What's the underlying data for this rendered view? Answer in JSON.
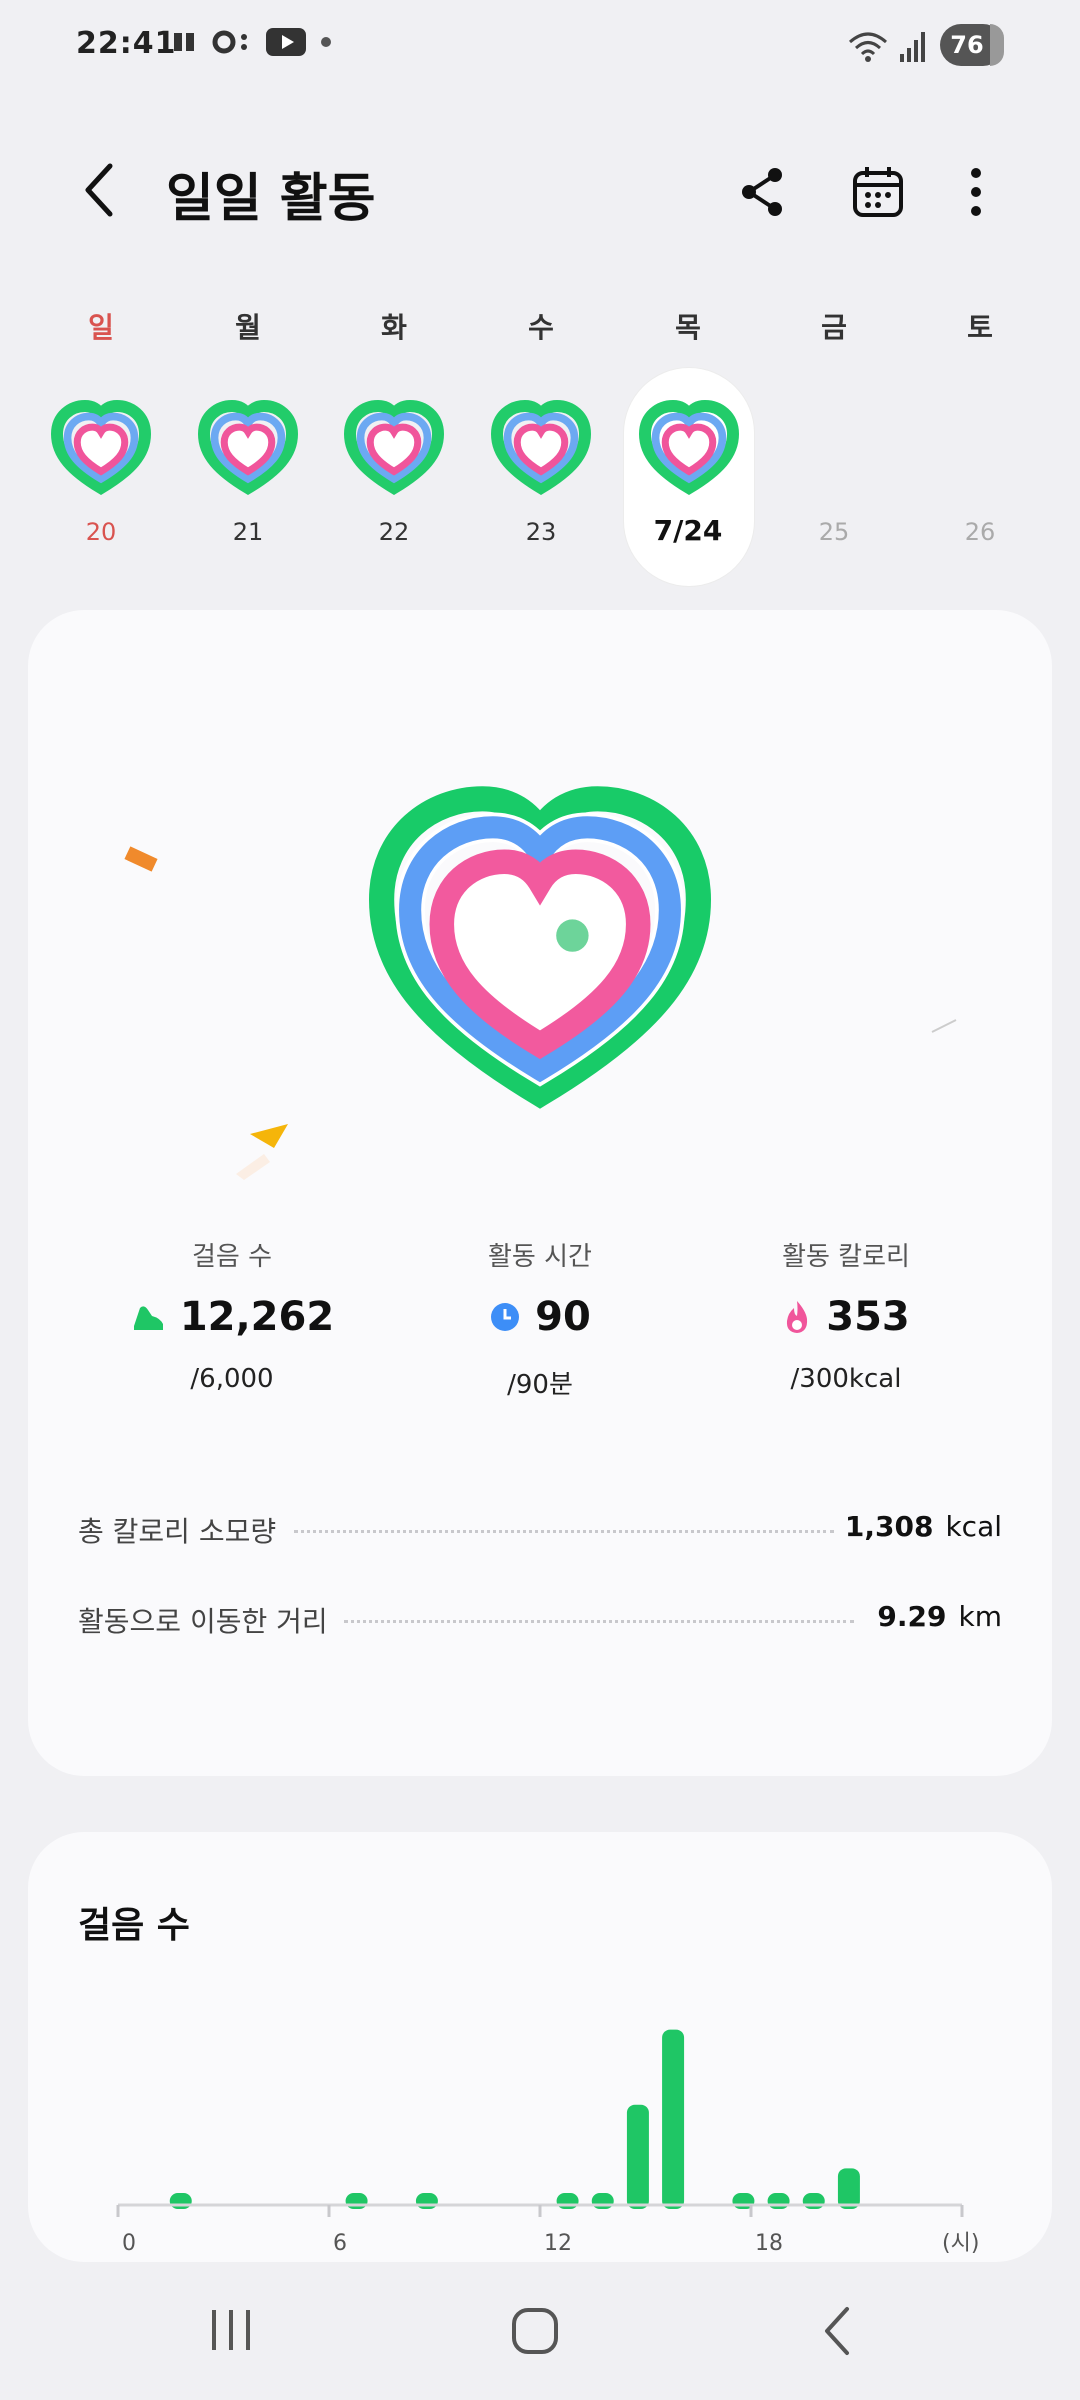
{
  "status": {
    "time": "22:41",
    "battery": "76"
  },
  "header": {
    "title": "일일 활동"
  },
  "week": {
    "day_labels": [
      "일",
      "월",
      "화",
      "수",
      "목",
      "금",
      "토"
    ],
    "dates": [
      "20",
      "21",
      "22",
      "23",
      "7/24",
      "25",
      "26"
    ]
  },
  "metrics": [
    {
      "label": "걸음 수",
      "value": "12,262",
      "goal": "/6,000",
      "icon": "shoe-icon",
      "color": "#1fc665"
    },
    {
      "label": "활동 시간",
      "value": "90",
      "goal": "/90분",
      "icon": "clock-icon",
      "color": "#3d8ef7"
    },
    {
      "label": "활동 칼로리",
      "value": "353",
      "goal": "/300kcal",
      "icon": "flame-icon",
      "color": "#f0559b"
    }
  ],
  "summary": {
    "total_calories_label": "총 칼로리 소모량",
    "total_calories_value": "1,308",
    "total_calories_unit": "kcal",
    "distance_label": "활동으로 이동한 거리",
    "distance_value": "9.29",
    "distance_unit": "km"
  },
  "steps_card": {
    "title": "걸음 수"
  },
  "chart_data": {
    "type": "bar",
    "xlabel": "(시)",
    "x_ticks": [
      "0",
      "6",
      "12",
      "18"
    ],
    "hours": [
      0,
      1,
      2,
      3,
      4,
      5,
      6,
      7,
      8,
      9,
      10,
      11,
      12,
      13,
      14,
      15,
      16,
      17,
      18,
      19,
      20,
      21,
      22,
      23
    ],
    "values": [
      0,
      40,
      0,
      0,
      0,
      0,
      40,
      0,
      40,
      0,
      0,
      0,
      40,
      40,
      1700,
      3000,
      0,
      40,
      40,
      40,
      600,
      0,
      0,
      0
    ],
    "ylim": [
      0,
      3200
    ],
    "bar_color": "#1fc665"
  }
}
